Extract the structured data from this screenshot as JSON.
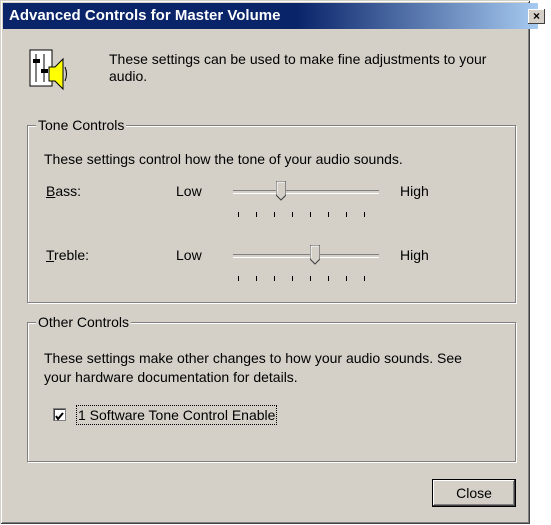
{
  "window": {
    "title": "Advanced Controls for Master Volume",
    "close_glyph": "×"
  },
  "intro": {
    "icon": "speaker-mixer-icon",
    "text": "These settings can be used to make fine adjustments to your audio."
  },
  "tone_controls": {
    "title": "Tone Controls",
    "description": "These settings control how the tone of your audio sounds.",
    "sliders": [
      {
        "label": "Bass:",
        "mnemonic": "B",
        "rest": "ass:",
        "low": "Low",
        "high": "High",
        "value_fraction": 0.33
      },
      {
        "label": "Treble:",
        "mnemonic": "T",
        "rest": "reble:",
        "low": "Low",
        "high": "High",
        "value_fraction": 0.56
      }
    ]
  },
  "other_controls": {
    "title": "Other Controls",
    "description_line1": "These settings make other changes to how your audio sounds.  See",
    "description_line2": "your hardware documentation for details.",
    "checkbox": {
      "label": "1  Software Tone Control Enable",
      "checked": true
    }
  },
  "buttons": {
    "close_label": "Close"
  }
}
